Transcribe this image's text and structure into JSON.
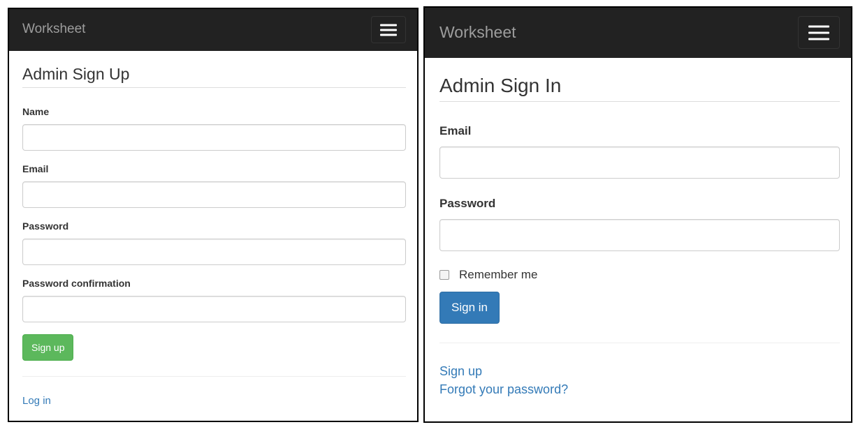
{
  "signup": {
    "brand": "Worksheet",
    "title": "Admin Sign Up",
    "fields": [
      {
        "label": "Name",
        "value": ""
      },
      {
        "label": "Email",
        "value": ""
      },
      {
        "label": "Password",
        "value": ""
      },
      {
        "label": "Password confirmation",
        "value": ""
      }
    ],
    "submit_label": "Sign up",
    "links": [
      "Log in"
    ]
  },
  "signin": {
    "brand": "Worksheet",
    "title": "Admin Sign In",
    "fields": [
      {
        "label": "Email",
        "value": ""
      },
      {
        "label": "Password",
        "value": ""
      }
    ],
    "remember_label": "Remember me",
    "remember_checked": false,
    "submit_label": "Sign in",
    "links": [
      "Sign up",
      "Forgot your password?"
    ]
  },
  "colors": {
    "navbar": "#222222",
    "brand_text": "#9d9d9d",
    "success": "#5cb85c",
    "primary": "#337ab7",
    "link": "#337ab7"
  },
  "icons": {
    "menu_toggle": "hamburger-menu-icon"
  }
}
